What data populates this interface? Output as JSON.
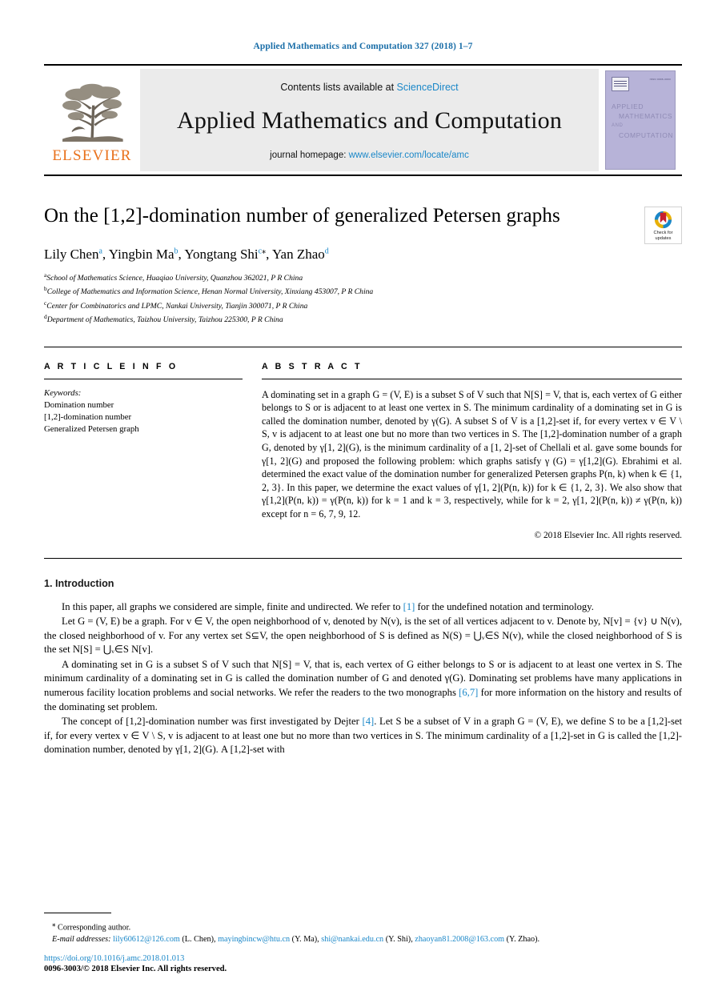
{
  "running_head": "Applied Mathematics and Computation 327 (2018) 1–7",
  "masthead": {
    "publisher_name": "ELSEVIER",
    "contents_prefix": "Contents lists available at",
    "contents_link": "ScienceDirect",
    "journal_title": "Applied Mathematics and Computation",
    "homepage_prefix": "journal homepage:",
    "homepage_link": "www.elsevier.com/locate/amc",
    "cover": {
      "line1": "APPLIED",
      "line2": "MATHEMATICS",
      "line3": "AND",
      "line4": "COMPUTATION",
      "issn": "ISSN 0096-3003"
    }
  },
  "article": {
    "title": "On the [1,2]-domination number of generalized Petersen graphs",
    "crossmark_label_line1": "Check for",
    "crossmark_label_line2": "updates",
    "authors": [
      {
        "name": "Lily Chen",
        "sup": "a"
      },
      {
        "name": "Yingbin Ma",
        "sup": "b"
      },
      {
        "name": "Yongtang Shi",
        "sup": "c",
        "star": true
      },
      {
        "name": "Yan Zhao",
        "sup": "d"
      }
    ],
    "affiliations": [
      {
        "marker": "a",
        "text": "School of Mathematics Science, Huaqiao University, Quanzhou 362021, P R China"
      },
      {
        "marker": "b",
        "text": "College of Mathematics and Information Science, Henan Normal University, Xinxiang 453007, P R China"
      },
      {
        "marker": "c",
        "text": "Center for Combinatorics and LPMC, Nankai University, Tianjin 300071, P R China"
      },
      {
        "marker": "d",
        "text": "Department of Mathematics, Taizhou University, Taizhou 225300, P R China"
      }
    ]
  },
  "article_info": {
    "heading": "A R T I C L E   I N F O",
    "keywords_label": "Keywords:",
    "keywords": [
      "Domination number",
      "[1,2]-domination number",
      "Generalized Petersen graph"
    ]
  },
  "abstract": {
    "heading": "A B S T R A C T",
    "paragraph_1": "A dominating set in a graph G = (V, E) is a subset S of V such that N[S] = V, that is, each vertex of G either belongs to S or is adjacent to at least one vertex in S. The minimum cardinality of a dominating set in G is called the domination number, denoted by γ(G). A subset S of V is a [1,2]-set if, for every vertex v ∈ V \\ S, v is adjacent to at least one but no more than two vertices in S. The [1,2]-domination number of a graph G, denoted by γ[1, 2](G), is the minimum cardinality of a [1, 2]-set of Chellali et al. gave some bounds for γ[1, 2](G) and proposed the following problem: which graphs satisfy γ (G) = γ[1,2](G). Ebrahimi et al. determined the exact value of the domination number for generalized Petersen graphs P(n, k) when k ∈ {1, 2, 3}. In this paper, we determine the exact values of γ[1, 2](P(n, k)) for k ∈ {1, 2, 3}. We also show that γ[1,2](P(n, k)) = γ(P(n, k)) for k = 1 and k = 3, respectively, while for k = 2, γ[1, 2](P(n, k)) ≠ γ(P(n, k)) except for n = 6, 7, 9, 12.",
    "copyright": "© 2018 Elsevier Inc. All rights reserved."
  },
  "introduction": {
    "heading": "1. Introduction",
    "p1": "In this paper, all graphs we considered are simple, finite and undirected. We refer to [1] for the undefined notation and terminology.",
    "p1_ref": "[1]",
    "p2": "Let G = (V, E) be a graph. For v ∈ V, the open neighborhood of v, denoted by N(v), is the set of all vertices adjacent to v. Denote by, N[v] = {v} ∪ N(v), the closed neighborhood of v. For any vertex set S⊆V, the open neighborhood of S is defined as N(S) = ⋃ᵥ∈S N(v), while the closed neighborhood of S is the set N[S] = ⋃ᵥ∈S N[v].",
    "p3": "A dominating set in G is a subset S of V such that N[S] = V, that is, each vertex of G either belongs to S or is adjacent to at least one vertex in S. The minimum cardinality of a dominating set in G is called the domination number of G and denoted γ(G). Dominating set problems have many applications in numerous facility location problems and social networks. We refer the readers to the two monographs [6,7] for more information on the history and results of the dominating set problem.",
    "p3_ref": "[6,7]",
    "p4": "The concept of [1,2]-domination number was first investigated by Dejter [4]. Let S be a subset of V in a graph G = (V, E), we define S to be a [1,2]-set if, for every vertex v ∈ V \\ S, v is adjacent to at least one but no more than two vertices in S. The minimum cardinality of a [1,2]-set in G is called the [1,2]-domination number, denoted by γ[1, 2](G). A [1,2]-set with",
    "p4_ref": "[4]"
  },
  "footer": {
    "corresponding_marker": "⁎",
    "corresponding_text": "Corresponding author.",
    "email_label": "E-mail addresses:",
    "emails": [
      {
        "address": "lily60612@126.com",
        "owner": "(L. Chen),"
      },
      {
        "address": "mayingbincw@htu.cn",
        "owner": "(Y. Ma),"
      },
      {
        "address": "shi@nankai.edu.cn",
        "owner": "(Y. Shi),"
      },
      {
        "address": "zhaoyan81.2008@163.com",
        "owner": "(Y. Zhao)."
      }
    ],
    "doi": "https://doi.org/10.1016/j.amc.2018.01.013",
    "issn_copyright": "0096-3003/© 2018 Elsevier Inc. All rights reserved."
  },
  "colors": {
    "link": "#1a87c8",
    "running_head": "#1a6ea8",
    "elsevier_orange": "#E9711C",
    "masthead_bg": "#ebebeb",
    "cover_bg": "#b7b3d8"
  }
}
